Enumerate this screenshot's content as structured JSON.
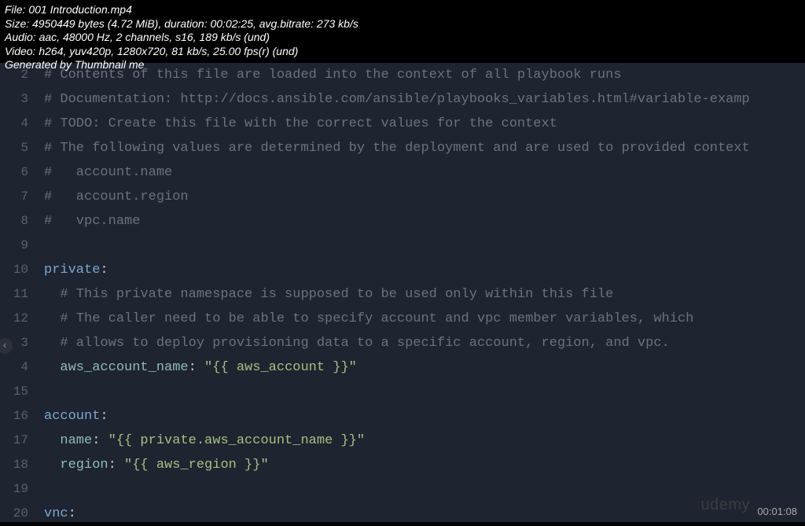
{
  "overlay": {
    "line1": "File: 001 Introduction.mp4",
    "line2": "Size: 4950449 bytes (4.72 MiB), duration: 00:02:25, avg.bitrate: 273 kb/s",
    "line3": "Audio: aac, 48000 Hz, 2 channels, s16, 189 kb/s (und)",
    "line4": "Video: h264, yuv420p, 1280x720, 81 kb/s, 25.00 fps(r) (und)",
    "line5": "Generated by Thumbnail me"
  },
  "timestamp": "00:01:08",
  "brand": "udemy",
  "lines": [
    {
      "n": "2",
      "tokens": [
        {
          "t": "# Contents of this file are loaded into the context of all playbook runs",
          "c": "cm"
        }
      ]
    },
    {
      "n": "3",
      "tokens": [
        {
          "t": "# Documentation: http://docs.ansible.com/ansible/playbooks_variables.html#variable-examp",
          "c": "cm"
        }
      ]
    },
    {
      "n": "4",
      "tokens": [
        {
          "t": "# TODO: Create this file with the correct values for the context",
          "c": "cm"
        }
      ]
    },
    {
      "n": "5",
      "tokens": [
        {
          "t": "# The following values are determined by the deployment and are used to provided context",
          "c": "cm"
        }
      ]
    },
    {
      "n": "6",
      "tokens": [
        {
          "t": "#   account.name",
          "c": "cm"
        }
      ]
    },
    {
      "n": "7",
      "tokens": [
        {
          "t": "#   account.region",
          "c": "cm"
        }
      ]
    },
    {
      "n": "8",
      "tokens": [
        {
          "t": "#   vpc.name",
          "c": "cm"
        }
      ]
    },
    {
      "n": "9",
      "tokens": []
    },
    {
      "n": "10",
      "tokens": [
        {
          "t": "private",
          "c": "kw"
        },
        {
          "t": ":",
          "c": "pn"
        }
      ]
    },
    {
      "n": "11",
      "tokens": [
        {
          "t": "  # This private namespace is supposed to be used only within this file",
          "c": "cm"
        }
      ]
    },
    {
      "n": "12",
      "tokens": [
        {
          "t": "  # The caller need to be able to specify account and vpc member variables, which",
          "c": "cm"
        }
      ]
    },
    {
      "n": "3",
      "tokens": [
        {
          "t": "  # allows to deploy provisioning data to a specific account, region, and vpc.",
          "c": "cm"
        }
      ]
    },
    {
      "n": "4",
      "tokens": [
        {
          "t": "  ",
          "c": "pn"
        },
        {
          "t": "aws_account_name",
          "c": "ky"
        },
        {
          "t": ": ",
          "c": "pn"
        },
        {
          "t": "\"{{ aws_account }}\"",
          "c": "str"
        }
      ]
    },
    {
      "n": "15",
      "tokens": []
    },
    {
      "n": "16",
      "tokens": [
        {
          "t": "account",
          "c": "kw"
        },
        {
          "t": ":",
          "c": "pn"
        }
      ]
    },
    {
      "n": "17",
      "tokens": [
        {
          "t": "  ",
          "c": "pn"
        },
        {
          "t": "name",
          "c": "ky"
        },
        {
          "t": ": ",
          "c": "pn"
        },
        {
          "t": "\"{{ private.aws_account_name }}\"",
          "c": "str"
        }
      ]
    },
    {
      "n": "18",
      "tokens": [
        {
          "t": "  ",
          "c": "pn"
        },
        {
          "t": "region",
          "c": "ky"
        },
        {
          "t": ": ",
          "c": "pn"
        },
        {
          "t": "\"{{ aws_region }}\"",
          "c": "str"
        }
      ]
    },
    {
      "n": "19",
      "tokens": []
    },
    {
      "n": "20",
      "tokens": [
        {
          "t": "vnc",
          "c": "kw"
        },
        {
          "t": ":",
          "c": "pn"
        }
      ]
    }
  ],
  "fold_glyph": "‹"
}
